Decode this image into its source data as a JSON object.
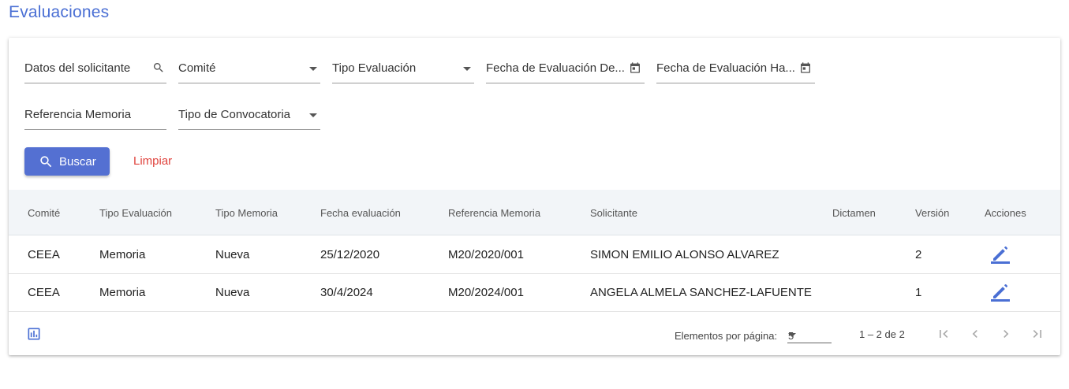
{
  "page": {
    "title": "Evaluaciones"
  },
  "filters": {
    "solicitante": "Datos del solicitante",
    "comite": "Comité",
    "tipo_evaluacion": "Tipo Evaluación",
    "fecha_desde": "Fecha de Evaluación De...",
    "fecha_hasta": "Fecha de Evaluación Ha...",
    "referencia_memoria": "Referencia Memoria",
    "tipo_convocatoria": "Tipo de Convocatoria",
    "buscar": "Buscar",
    "limpiar": "Limpiar"
  },
  "table": {
    "headers": [
      "Comité",
      "Tipo Evaluación",
      "Tipo Memoria",
      "Fecha evaluación",
      "Referencia Memoria",
      "Solicitante",
      "Dictamen",
      "Versión",
      "Acciones"
    ],
    "rows": [
      {
        "comite": "CEEA",
        "tipo_evaluacion": "Memoria",
        "tipo_memoria": "Nueva",
        "fecha": "25/12/2020",
        "referencia": "M20/2020/001",
        "solicitante": "SIMON EMILIO ALONSO ALVAREZ",
        "dictamen": "",
        "version": "2"
      },
      {
        "comite": "CEEA",
        "tipo_evaluacion": "Memoria",
        "tipo_memoria": "Nueva",
        "fecha": "30/4/2024",
        "referencia": "M20/2024/001",
        "solicitante": "ANGELA ALMELA SANCHEZ-LAFUENTE",
        "dictamen": "",
        "version": "1"
      }
    ]
  },
  "paginator": {
    "items_label": "Elementos por página:",
    "page_size": "5",
    "range": "1 – 2 de 2"
  },
  "colors": {
    "accent": "#5470d2",
    "title": "#4a6fd4",
    "clear": "#e0443e"
  },
  "icons": [
    "search-icon",
    "calendar-icon",
    "edit-icon",
    "chart-icon",
    "first-page-icon",
    "prev-page-icon",
    "next-page-icon",
    "last-page-icon"
  ]
}
